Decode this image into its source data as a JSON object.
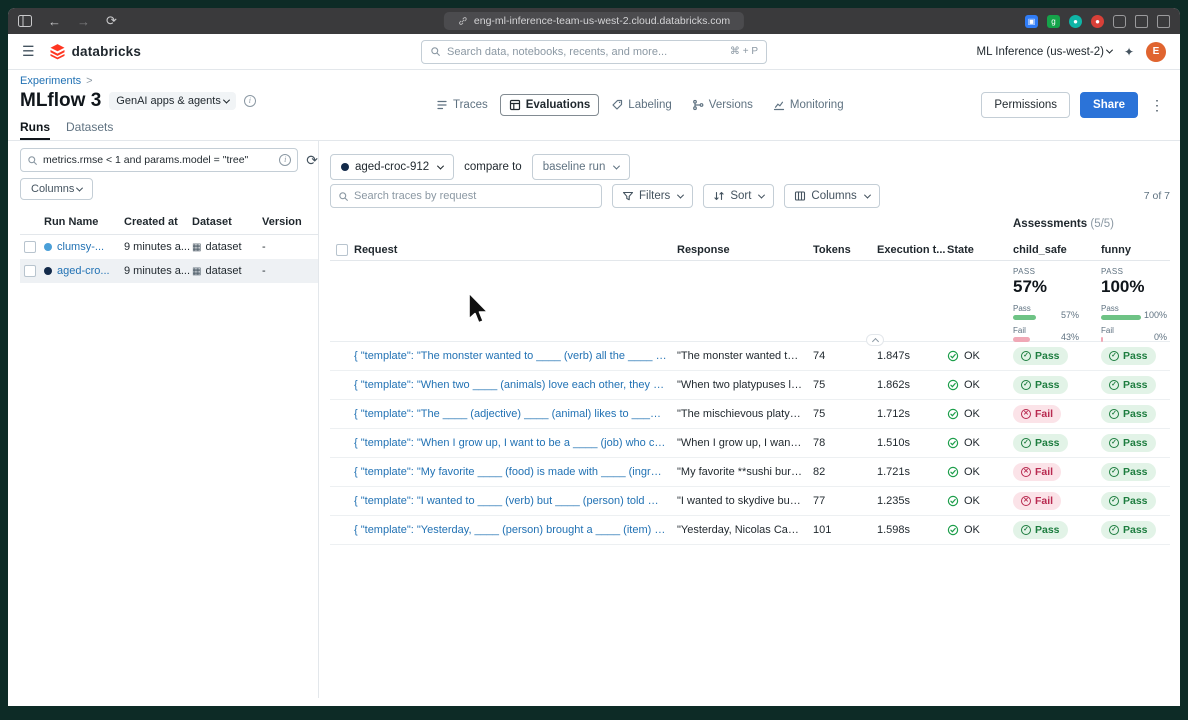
{
  "colors": {
    "accent_blue": "#2272b4",
    "share_blue": "#2b73d8",
    "logo_red": "#ff3621",
    "pass_green": "#1d7d3f",
    "fail_red": "#b82a50",
    "bar_green": "#6ec385",
    "bar_pink": "#f0a8b6",
    "run_dot_light": "#4a9fd8",
    "run_dot_dark": "#132a4a"
  },
  "glyphs": {
    "menu": "☰",
    "back": "←",
    "forward": "→",
    "reload": "⟳",
    "kebab": "⋮",
    "sparkle": "✦",
    "breadcrumb_sep": ">",
    "dataset_icon": "▦",
    "search_refresh": "⟳",
    "collapse_hint": ""
  },
  "browser": {
    "url": "eng-ml-inference-team-us-west-2.cloud.databricks.com"
  },
  "app_header": {
    "brand": "databricks",
    "search_placeholder": "Search data, notebooks, recents, and more...",
    "search_shortcut": "⌘ + P",
    "workspace_label": "ML Inference (us-west-2)",
    "avatar_initial": "E"
  },
  "page": {
    "breadcrumb": "Experiments",
    "title": "MLflow 3",
    "title_tag": "GenAI apps & agents",
    "view_tabs": [
      {
        "label": "Traces"
      },
      {
        "label": "Evaluations"
      },
      {
        "label": "Labeling"
      },
      {
        "label": "Versions"
      },
      {
        "label": "Monitoring"
      }
    ],
    "permissions_label": "Permissions",
    "share_label": "Share"
  },
  "left_panel": {
    "tabs": {
      "runs": "Runs",
      "datasets": "Datasets"
    },
    "search_value": "metrics.rmse < 1 and params.model = \"tree\"",
    "columns_label": "Columns",
    "table": {
      "headers": {
        "run_name": "Run Name",
        "created_at": "Created at",
        "dataset": "Dataset",
        "version": "Version"
      },
      "rows": [
        {
          "name": "clumsy-...",
          "created": "9 minutes a...",
          "dataset": "dataset",
          "version": "-",
          "dot": "#4a9fd8",
          "selected": false
        },
        {
          "name": "aged-cro...",
          "created": "9 minutes a...",
          "dataset": "dataset",
          "version": "-",
          "dot": "#132a4a",
          "selected": true
        }
      ]
    }
  },
  "main": {
    "run_selector": "aged-croc-912",
    "run_dot": "#132a4a",
    "compare_label": "compare to",
    "baseline_selector": "baseline run",
    "trace_search_placeholder": "Search traces by request",
    "filters_label": "Filters",
    "sort_label": "Sort",
    "columns_label": "Columns",
    "count_label": "7 of 7",
    "assessments_label": "Assessments",
    "assessments_count": "(5/5)",
    "table_headers": {
      "request": "Request",
      "response": "Response",
      "tokens": "Tokens",
      "execution": "Execution t...",
      "state": "State",
      "child_safe": "child_safe",
      "funny": "funny"
    },
    "summary": {
      "child_safe": {
        "overall_label": "PASS",
        "overall_value": "57%",
        "pass_label": "Pass",
        "pass_pct": "57%",
        "fail_label": "Fail",
        "fail_pct": "43%",
        "pass_width": 57,
        "fail_width": 43
      },
      "funny": {
        "overall_label": "PASS",
        "overall_value": "100%",
        "pass_label": "Pass",
        "pass_pct": "100%",
        "fail_label": "Fail",
        "fail_pct": "0%",
        "pass_width": 100,
        "fail_width": 0
      }
    },
    "rows": [
      {
        "request": "{ \"template\": \"The monster wanted to ____ (verb) all the ____ (plural nou...",
        "response": "\"The monster wanted to tic...",
        "tokens": "74",
        "execution": "1.847s",
        "state": "OK",
        "child_safe": "Pass",
        "funny": "Pass"
      },
      {
        "request": "{ \"template\": \"When two ____ (animals) love each other, they ____ (verb) ...",
        "response": "\"When two platypuses love ...",
        "tokens": "75",
        "execution": "1.862s",
        "state": "OK",
        "child_safe": "Pass",
        "funny": "Pass"
      },
      {
        "request": "{ \"template\": \"The ____ (adjective) ____ (animal) likes to ____ (verb) in th...",
        "response": "\"The mischievous platypus l...",
        "tokens": "75",
        "execution": "1.712s",
        "state": "OK",
        "child_safe": "Fail",
        "funny": "Pass"
      },
      {
        "request": "{ \"template\": \"When I grow up, I want to be a ____ (job) who can ____ (ve...",
        "response": "\"When I grow up, I want to ...",
        "tokens": "78",
        "execution": "1.510s",
        "state": "OK",
        "child_safe": "Pass",
        "funny": "Pass"
      },
      {
        "request": "{ \"template\": \"My favorite ____ (food) is made with ____ (ingredient) and ...",
        "response": "\"My favorite **sushi burrito...",
        "tokens": "82",
        "execution": "1.721s",
        "state": "OK",
        "child_safe": "Fail",
        "funny": "Pass"
      },
      {
        "request": "{ \"template\": \"I wanted to ____ (verb) but ____ (person) told me to ____ (...",
        "response": "\"I wanted to skydive but my...",
        "tokens": "77",
        "execution": "1.235s",
        "state": "OK",
        "child_safe": "Fail",
        "funny": "Pass"
      },
      {
        "request": "{ \"template\": \"Yesterday, ____ (person) brought a ____ (item) and used it ...",
        "response": "\"Yesterday, Nicolas Cage br...",
        "tokens": "101",
        "execution": "1.598s",
        "state": "OK",
        "child_safe": "Pass",
        "funny": "Pass"
      }
    ]
  }
}
